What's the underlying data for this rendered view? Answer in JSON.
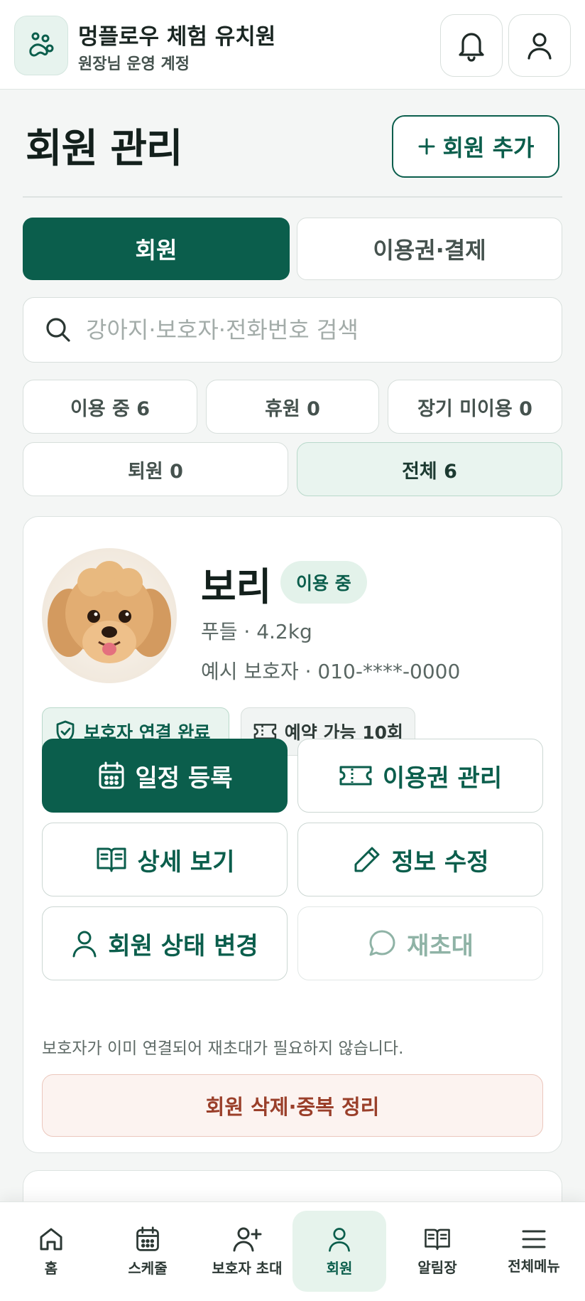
{
  "header": {
    "title": "멍플로우 체험 유치원",
    "subtitle": "원장님 운영 계정",
    "icons": [
      "paw-logo-icon",
      "bell-icon",
      "user-icon"
    ]
  },
  "page": {
    "title": "회원 관리",
    "add_button": "회원 추가"
  },
  "tabs": [
    "회원",
    "이용권·결제"
  ],
  "search": {
    "placeholder": "강아지·보호자·전화번호 검색",
    "value": ""
  },
  "filters": [
    {
      "label": "이용 중 6",
      "selected": false
    },
    {
      "label": "휴원 0",
      "selected": false
    },
    {
      "label": "장기 미이용 0",
      "selected": false
    },
    {
      "label": "퇴원 0",
      "selected": false
    },
    {
      "label": "전체 6",
      "selected": true
    }
  ],
  "member": {
    "name": "보리",
    "status": "이용 중",
    "breed_weight": "푸들 · 4.2kg",
    "guardian": "예시 보호자 · 010-****-0000",
    "badges": [
      "보호자 연결 완료",
      "예약 가능 10회"
    ],
    "actions": {
      "schedule": "일정 등록",
      "pass": "이용권 관리",
      "detail": "상세 보기",
      "edit": "정보 수정",
      "status_change": "회원 상태 변경",
      "reinvite": "재초대"
    },
    "note": "보호자가 이미 연결되어 재초대가 필요하지 않습니다.",
    "delete": "회원 삭제·중복 정리"
  },
  "bottom_nav": [
    "홈",
    "스케줄",
    "보호자 초대",
    "회원",
    "알림장",
    "전체메뉴"
  ],
  "bottom_nav_active": "회원",
  "colors": {
    "primary": "#0b5e4c",
    "primary_light": "#e9f4ef",
    "danger": "#9a3f2a",
    "danger_bg": "#fcf3f0"
  }
}
